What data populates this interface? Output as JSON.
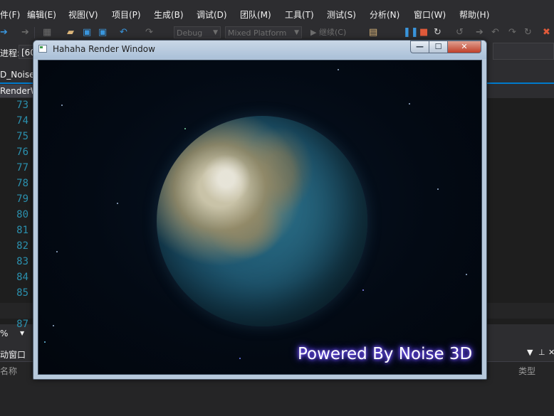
{
  "menubar": {
    "items": [
      "件(F)",
      "编辑(E)",
      "视图(V)",
      "项目(P)",
      "生成(B)",
      "调试(D)",
      "团队(M)",
      "工具(T)",
      "测试(S)",
      "分析(N)",
      "窗口(W)",
      "帮助(H)"
    ]
  },
  "toolbar": {
    "config": "Debug",
    "platform": "Mixed Platform",
    "continue": "继续(C)"
  },
  "process": {
    "label": "进程:",
    "value": "[60"
  },
  "tabs": {
    "file_tab": "D_Noise",
    "render_tab": "RenderW"
  },
  "editor": {
    "line_numbers": [
      "73",
      "74",
      "75",
      "76",
      "77",
      "78",
      "79",
      "80",
      "81",
      "82",
      "83",
      "84",
      "85",
      "86",
      "87"
    ]
  },
  "zoom": "%",
  "bottom_panel": {
    "title": "动窗口",
    "col_name": "名称",
    "col_type": "类型"
  },
  "render_window": {
    "title": "Hahaha Render Window",
    "overlay_text": "Powered By Noise 3D",
    "buttons": {
      "minimize": "—",
      "maximize": "☐",
      "close": "✕"
    }
  },
  "colors": {
    "ide_bg": "#2d2d30",
    "editor_bg": "#1e1e1e",
    "line_number": "#2b91af",
    "accent": "#007acc",
    "glow": "#6a4cff"
  }
}
